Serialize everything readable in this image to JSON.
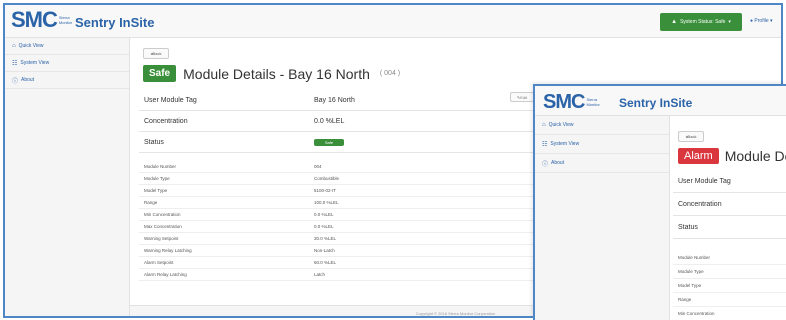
{
  "back": {
    "logo": {
      "mark": "SMC",
      "tagline": "Sierra Monitor"
    },
    "brand": "Sentry InSite",
    "status_button": "System Status: Safe",
    "profile": "Profile",
    "sidebar": [
      {
        "icon": "home-icon",
        "label": "Quick View"
      },
      {
        "icon": "sitemap-icon",
        "label": "System View"
      },
      {
        "icon": "info-icon",
        "label": "About"
      }
    ],
    "back_button": "Back",
    "edit_button": "Edit",
    "badge": "Safe",
    "title": "Module Details - Bay 16 North",
    "title_code": "( 004 )",
    "main_rows": [
      {
        "label": "User Module Tag",
        "value": "Bay 16 North"
      },
      {
        "label": "Concentration",
        "value": "0.0 %LEL"
      },
      {
        "label": "Status",
        "value": "Safe"
      }
    ],
    "detail_rows": [
      {
        "label": "Module Number",
        "value": "004"
      },
      {
        "label": "Module Type",
        "value": "Combustible"
      },
      {
        "label": "Model Type",
        "value": "5100-02-IT"
      },
      {
        "label": "Range",
        "value": "100.0 %LEL"
      },
      {
        "label": "Min Concentration",
        "value": "0.0 %LEL"
      },
      {
        "label": "Max Concentration",
        "value": "0.0 %LEL"
      },
      {
        "label": "Warning Setpoint",
        "value": "30.0 %LEL"
      },
      {
        "label": "Warning Relay Latching",
        "value": "Non-Latch"
      },
      {
        "label": "Alarm Setpoint",
        "value": "60.0 %LEL"
      },
      {
        "label": "Alarm Relay Latching",
        "value": "Latch"
      }
    ],
    "footer": "Copyright © 2016 Sierra Monitor Corporation"
  },
  "front": {
    "logo": {
      "mark": "SMC",
      "tagline": "Sierra Monitor"
    },
    "brand": "Sentry InSite",
    "sidebar": [
      {
        "icon": "home-icon",
        "label": "Quick View"
      },
      {
        "icon": "sitemap-icon",
        "label": "System View"
      },
      {
        "icon": "info-icon",
        "label": "About"
      }
    ],
    "back_button": "Back",
    "badge": "Alarm",
    "title": "Module De",
    "main_rows": [
      {
        "label": "User Module Tag"
      },
      {
        "label": "Concentration"
      },
      {
        "label": "Status"
      }
    ],
    "detail_rows": [
      {
        "label": "Module Number"
      },
      {
        "label": "Module Type"
      },
      {
        "label": "Model Type"
      },
      {
        "label": "Range"
      },
      {
        "label": "Min Concentration"
      }
    ]
  },
  "colors": {
    "brand_blue": "#2b63a8",
    "safe_green": "#3a8f3a",
    "alarm_red": "#d9363e",
    "frame_blue": "#4f86c6"
  }
}
